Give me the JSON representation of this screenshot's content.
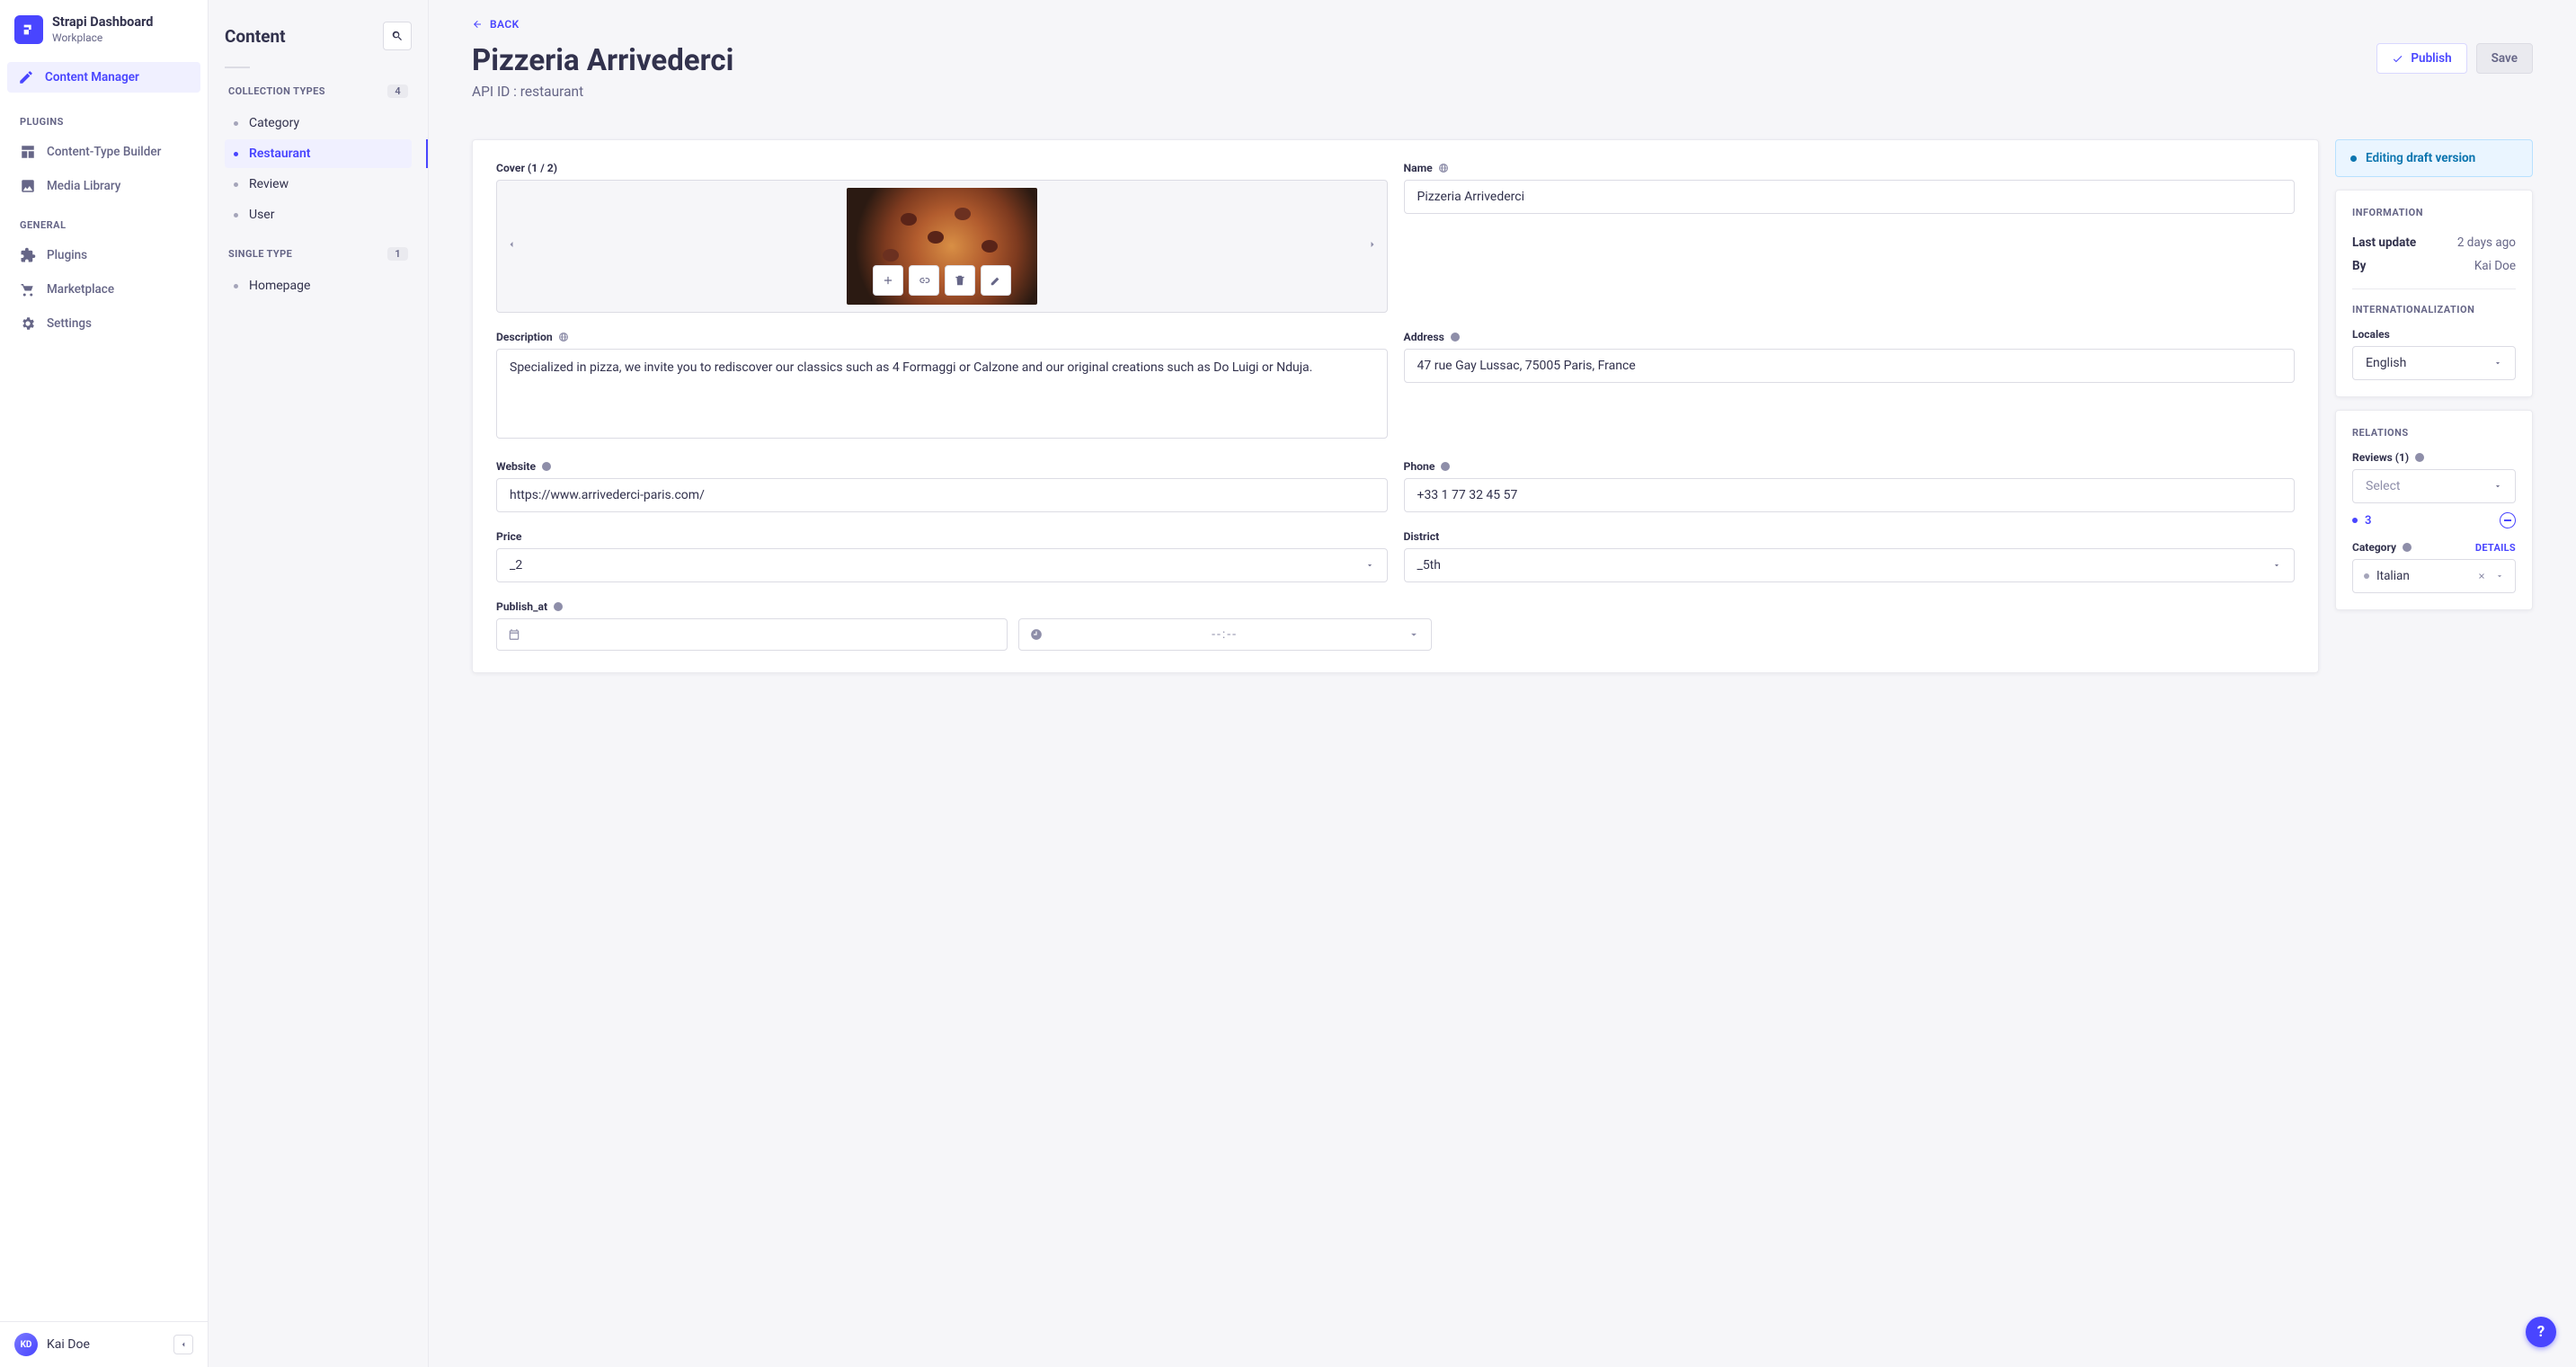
{
  "brand": {
    "title": "Strapi Dashboard",
    "subtitle": "Workplace"
  },
  "nav": {
    "active": "Content Manager",
    "plugins_label": "PLUGINS",
    "plugins": [
      "Content-Type Builder",
      "Media Library"
    ],
    "general_label": "GENERAL",
    "general": [
      "Plugins",
      "Marketplace",
      "Settings"
    ]
  },
  "user": {
    "initials": "KD",
    "name": "Kai Doe"
  },
  "subnav": {
    "title": "Content",
    "collection_label": "COLLECTION TYPES",
    "collection_count": "4",
    "collection_items": [
      "Category",
      "Restaurant",
      "Review",
      "User"
    ],
    "collection_active_index": 1,
    "single_label": "SINGLE TYPE",
    "single_count": "1",
    "single_items": [
      "Homepage"
    ]
  },
  "header": {
    "back": "BACK",
    "title": "Pizzeria Arrivederci",
    "subtitle": "API ID : restaurant",
    "publish": "Publish",
    "save": "Save"
  },
  "form": {
    "cover_label": "Cover (1 / 2)",
    "name_label": "Name",
    "name_value": "Pizzeria Arrivederci",
    "description_label": "Description",
    "description_value": "Specialized in pizza, we invite you to rediscover our classics such as 4 Formaggi or Calzone and our original creations such as Do Luigi or Nduja.",
    "address_label": "Address",
    "address_value": "47 rue Gay Lussac, 75005 Paris, France",
    "website_label": "Website",
    "website_value": "https://www.arrivederci-paris.com/",
    "phone_label": "Phone",
    "phone_value": "+33 1 77 32 45 57",
    "price_label": "Price",
    "price_value": "_2",
    "district_label": "District",
    "district_value": "_5th",
    "publish_at_label": "Publish_at",
    "time_placeholder": "--:--"
  },
  "status": {
    "prefix": "Editing ",
    "strong": "draft version"
  },
  "info_panel": {
    "title": "INFORMATION",
    "last_update_k": "Last update",
    "last_update_v": "2 days ago",
    "by_k": "By",
    "by_v": "Kai Doe",
    "i18n_title": "INTERNATIONALIZATION",
    "locales_label": "Locales",
    "locale_value": "English"
  },
  "relations_panel": {
    "title": "RELATIONS",
    "reviews_label": "Reviews (1)",
    "select_placeholder": "Select",
    "review_item": "3",
    "category_label": "Category",
    "details": "DETAILS",
    "category_value": "Italian"
  },
  "help": "?"
}
